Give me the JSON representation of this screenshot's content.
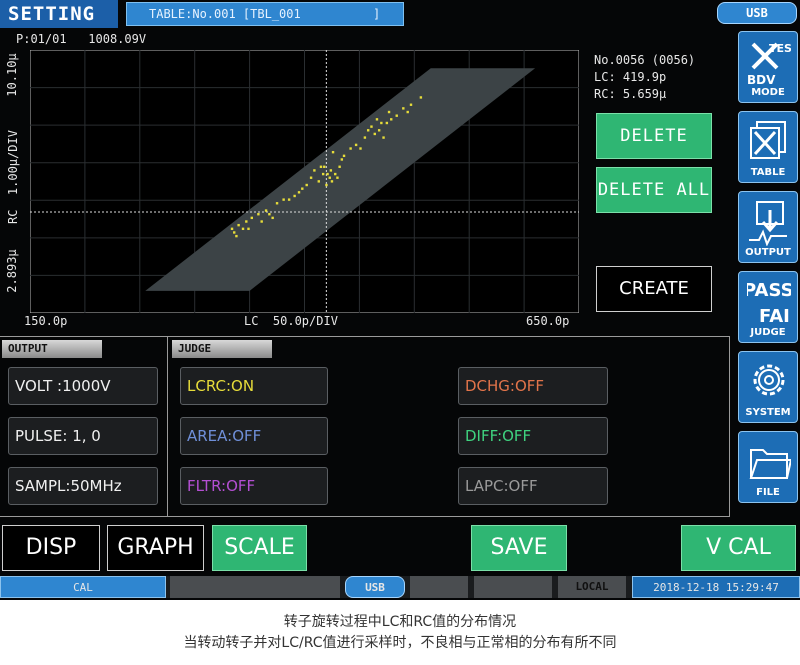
{
  "header": {
    "mode_title": "SETTING",
    "table_field": "TABLE:No.001 [TBL_001          ]",
    "usb_label": "USB"
  },
  "graph": {
    "page": "P:01/01",
    "voltage": "1008.09V",
    "y_top_label": "10.10µ",
    "y_mid_label": "RC  1.00µ/DIV",
    "y_bottom_label": "2.893µ",
    "x_left_label": "150.0p",
    "x_mid_label": "LC  50.0p/DIV",
    "x_right_label": "650.0p"
  },
  "chart_data": {
    "type": "scatter",
    "xlabel": "LC",
    "ylabel": "RC",
    "x_unit": "p",
    "y_unit": "µ",
    "xlim": [
      150.0,
      650.0
    ],
    "x_div": 50.0,
    "ylim": [
      2.893,
      10.1
    ],
    "y_div": 1.0,
    "cursor": {
      "x": 419.9,
      "y": 5.659
    },
    "band_color": "#3c4346",
    "point_color": "#e6dc3a",
    "points": [
      [
        334,
        5.2
      ],
      [
        336,
        5.1
      ],
      [
        338,
        5.0
      ],
      [
        340,
        5.3
      ],
      [
        344,
        5.2
      ],
      [
        347,
        5.4
      ],
      [
        349,
        5.2
      ],
      [
        352,
        5.5
      ],
      [
        358,
        5.6
      ],
      [
        361,
        5.4
      ],
      [
        365,
        5.7
      ],
      [
        368,
        5.6
      ],
      [
        371,
        5.5
      ],
      [
        375,
        5.9
      ],
      [
        381,
        6.0
      ],
      [
        386,
        6.0
      ],
      [
        391,
        6.1
      ],
      [
        395,
        6.2
      ],
      [
        398,
        6.3
      ],
      [
        402,
        6.4
      ],
      [
        406,
        6.6
      ],
      [
        409,
        6.8
      ],
      [
        413,
        6.5
      ],
      [
        415,
        6.9
      ],
      [
        417,
        6.7
      ],
      [
        418,
        6.9
      ],
      [
        420,
        6.4
      ],
      [
        421,
        6.7
      ],
      [
        423,
        6.6
      ],
      [
        424,
        6.8
      ],
      [
        425,
        6.5
      ],
      [
        426,
        7.3
      ],
      [
        428,
        6.7
      ],
      [
        430,
        6.6
      ],
      [
        432,
        6.9
      ],
      [
        434,
        7.1
      ],
      [
        436,
        7.2
      ],
      [
        442,
        7.4
      ],
      [
        447,
        7.5
      ],
      [
        451,
        7.4
      ],
      [
        455,
        7.7
      ],
      [
        458,
        7.9
      ],
      [
        461,
        8.0
      ],
      [
        464,
        7.8
      ],
      [
        466,
        8.2
      ],
      [
        468,
        7.9
      ],
      [
        470,
        8.1
      ],
      [
        472,
        7.7
      ],
      [
        475,
        8.1
      ],
      [
        477,
        8.4
      ],
      [
        479,
        8.2
      ],
      [
        484,
        8.3
      ],
      [
        490,
        8.5
      ],
      [
        494,
        8.4
      ],
      [
        497,
        8.6
      ],
      [
        506,
        8.8
      ]
    ]
  },
  "readout": {
    "count": "No.0056 (0056)",
    "lc": "LC: 419.9p",
    "rc": "RC: 5.659µ"
  },
  "actions": {
    "delete": "DELETE",
    "delete_all": "DELETE ALL",
    "create": "CREATE"
  },
  "sidebar": {
    "mode": "MODE",
    "mode_icon_text_1": "TEST",
    "mode_icon_text_2": "BDV",
    "table": "TABLE",
    "output": "OUTPUT",
    "judge": "JUDGE",
    "judge_icon_text_1": "PASS",
    "judge_icon_text_2": "FAIL",
    "system": "SYSTEM",
    "file": "FILE"
  },
  "output_panel": {
    "tag": "OUTPUT",
    "volt": "VOLT :1000V",
    "pulse": "PULSE: 1, 0",
    "sampl": "SAMPL:50MHz"
  },
  "judge_panel": {
    "tag": "JUDGE",
    "lcrc": "LCRC:ON",
    "area": "AREA:OFF",
    "fltr": "FLTR:OFF",
    "dchg": "DCHG:OFF",
    "diff": "DIFF:OFF",
    "lapc": "LAPC:OFF"
  },
  "colors": {
    "lcrc": "#e6dc3a",
    "area": "#6f8fd8",
    "fltr": "#b34fd2",
    "dchg": "#e2744a",
    "diff": "#3fd27f",
    "lapc": "#9a9a9a",
    "green_button": "#2fb673",
    "blue_accent": "#1d6db5"
  },
  "bottom": {
    "disp": "DISP",
    "graph": "GRAPH",
    "scale": "SCALE",
    "save": "SAVE",
    "vcal": "V CAL"
  },
  "status": {
    "cal": "CAL",
    "usb": "USB",
    "local": "LOCAL",
    "datetime": "2018-12-18 15:29:47"
  },
  "caption": {
    "line1": "转子旋转过程中LC和RC值的分布情况",
    "line2": "当转动转子并对LC/RC值进行采样时，不良相与正常相的分布有所不同"
  }
}
